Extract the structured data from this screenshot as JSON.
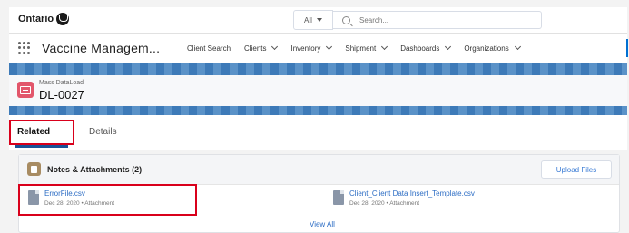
{
  "org": {
    "logo_text": "Ontario"
  },
  "search": {
    "scope": "All",
    "placeholder": "Search..."
  },
  "app": {
    "name": "Vaccine Managem..."
  },
  "nav": {
    "items": [
      {
        "label": "Client Search",
        "dropdown": false
      },
      {
        "label": "Clients",
        "dropdown": true
      },
      {
        "label": "Inventory",
        "dropdown": true
      },
      {
        "label": "Shipment",
        "dropdown": true
      },
      {
        "label": "Dashboards",
        "dropdown": true
      },
      {
        "label": "Organizations",
        "dropdown": true
      }
    ]
  },
  "record": {
    "type": "Mass DataLoad",
    "id": "DL-0027"
  },
  "tabs": [
    {
      "label": "Related",
      "active": true,
      "highlighted": true
    },
    {
      "label": "Details",
      "active": false
    }
  ],
  "notes": {
    "title": "Notes & Attachments (2)",
    "upload_label": "Upload Files",
    "files": [
      {
        "name": "ErrorFile.csv",
        "meta": "Dec 28, 2020 • Attachment",
        "highlighted": true
      },
      {
        "name": "Client_Client Data Insert_Template.csv",
        "meta": "Dec 28, 2020 • Attachment",
        "highlighted": false
      }
    ],
    "view_all": "View All"
  },
  "colors": {
    "accent": "#0070d2",
    "highlight": "#d9001b",
    "record_icon": "#e2566b",
    "notes_icon": "#a88c63",
    "link": "#2b6cc4"
  }
}
